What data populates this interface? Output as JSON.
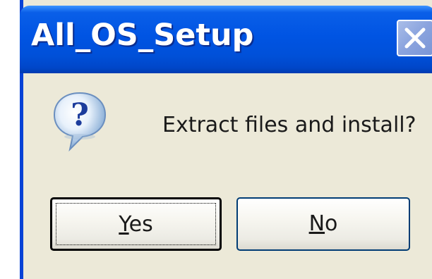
{
  "dialog": {
    "title": "All_OS_Setup",
    "message": "Extract files and install?",
    "close_icon": "close-icon",
    "question_icon": "question-icon",
    "buttons": {
      "yes": {
        "mnemonic": "Y",
        "rest": "es"
      },
      "no": {
        "mnemonic": "N",
        "rest": "o"
      }
    }
  },
  "colors": {
    "titlebar": "#0054e3",
    "body": "#ece9d8",
    "focus_border": "#000000"
  }
}
